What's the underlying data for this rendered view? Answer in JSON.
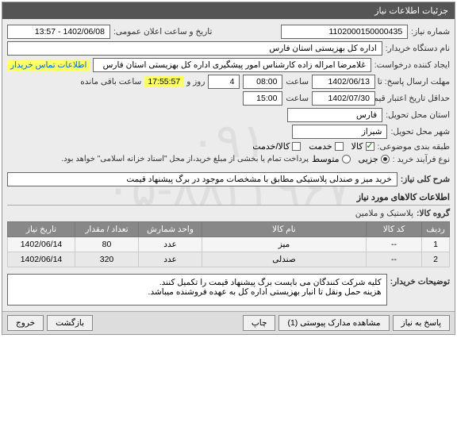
{
  "header": {
    "title": "جزئیات اطلاعات نیاز"
  },
  "fields": {
    "need_no_lbl": "شماره نیاز:",
    "need_no": "1102000150000435",
    "announce_lbl": "تاریخ و ساعت اعلان عمومی:",
    "announce": "1402/06/08 - 13:57",
    "buyer_org_lbl": "نام دستگاه خریدار:",
    "buyer_org": "اداره کل بهزیستی استان فارس",
    "creator_lbl": "ایجاد کننده درخواست:",
    "creator": "غلامرضا امراله زاده کارشناس امور پیشگیری اداره کل بهزیستی استان فارس",
    "contact_link": "اطلاعات تماس خریدار",
    "reply_deadline_lbl": "مهلت ارسال پاسخ: تا تاریخ:",
    "reply_deadline_date": "1402/06/13",
    "time_lbl": "ساعت",
    "reply_deadline_time": "08:00",
    "days_lbl": "روز و",
    "days": "4",
    "countdown": "17:55:57",
    "remain_lbl": "ساعت باقی مانده",
    "validity_lbl": "حداقل تاریخ اعتبار قیمت: تا تاریخ:",
    "validity_date": "1402/07/30",
    "validity_time": "15:00",
    "province_lbl": "استان محل تحویل:",
    "province": "فارس",
    "city_lbl": "شهر محل تحویل:",
    "city": "شیراز",
    "category_lbl": "طبقه بندی موضوعی:",
    "cat_goods": "کالا",
    "cat_service": "خدمت",
    "cat_goods_service": "کالا/خدمت",
    "purchase_type_lbl": "نوع فرآیند خرید :",
    "pt_partial": "جزیی",
    "pt_medium": "متوسط",
    "pt_note": "پرداخت تمام یا بخشی از مبلغ خرید،از محل \"اسناد خزانه اسلامی\" خواهد بود.",
    "summary_lbl": "شرح کلی نیاز:",
    "summary": "خرید میز و صندلی پلاستیکی مطابق با مشخصات موجود در برگ پیشنهاد قیمت",
    "items_section": "اطلاعات کالاهای مورد نیاز",
    "group_lbl": "گروه کالا:",
    "group": "پلاستیک و ملامین",
    "buyer_notes_lbl": "توضیحات خریدار:",
    "buyer_notes_1": "کلیه شرکت کنندگان می بایست برگ پیشنهاد قیمت را تکمیل کنند.",
    "buyer_notes_2": "هزینه حمل ونقل تا انبار بهزیستی اداره کل به عهده فروشنده میباشد."
  },
  "table": {
    "headers": {
      "row": "ردیف",
      "code": "کد کالا",
      "name": "نام کالا",
      "unit": "واحد شمارش",
      "qty": "تعداد / مقدار",
      "date": "تاریخ نیاز"
    },
    "rows": [
      {
        "n": "1",
        "code": "--",
        "name": "میز",
        "unit": "عدد",
        "qty": "80",
        "date": "1402/06/14"
      },
      {
        "n": "2",
        "code": "--",
        "name": "صندلی",
        "unit": "عدد",
        "qty": "320",
        "date": "1402/06/14"
      }
    ]
  },
  "footer": {
    "reply": "پاسخ به نیاز",
    "attachments": "مشاهده مدارک پیوستی (1)",
    "print": "چاپ",
    "back": "بازگشت",
    "exit": "خروج"
  },
  "watermark": {
    "line1": "۰۹۱",
    "line2": "۰۵-۸۸۳۴۹۶۷"
  }
}
